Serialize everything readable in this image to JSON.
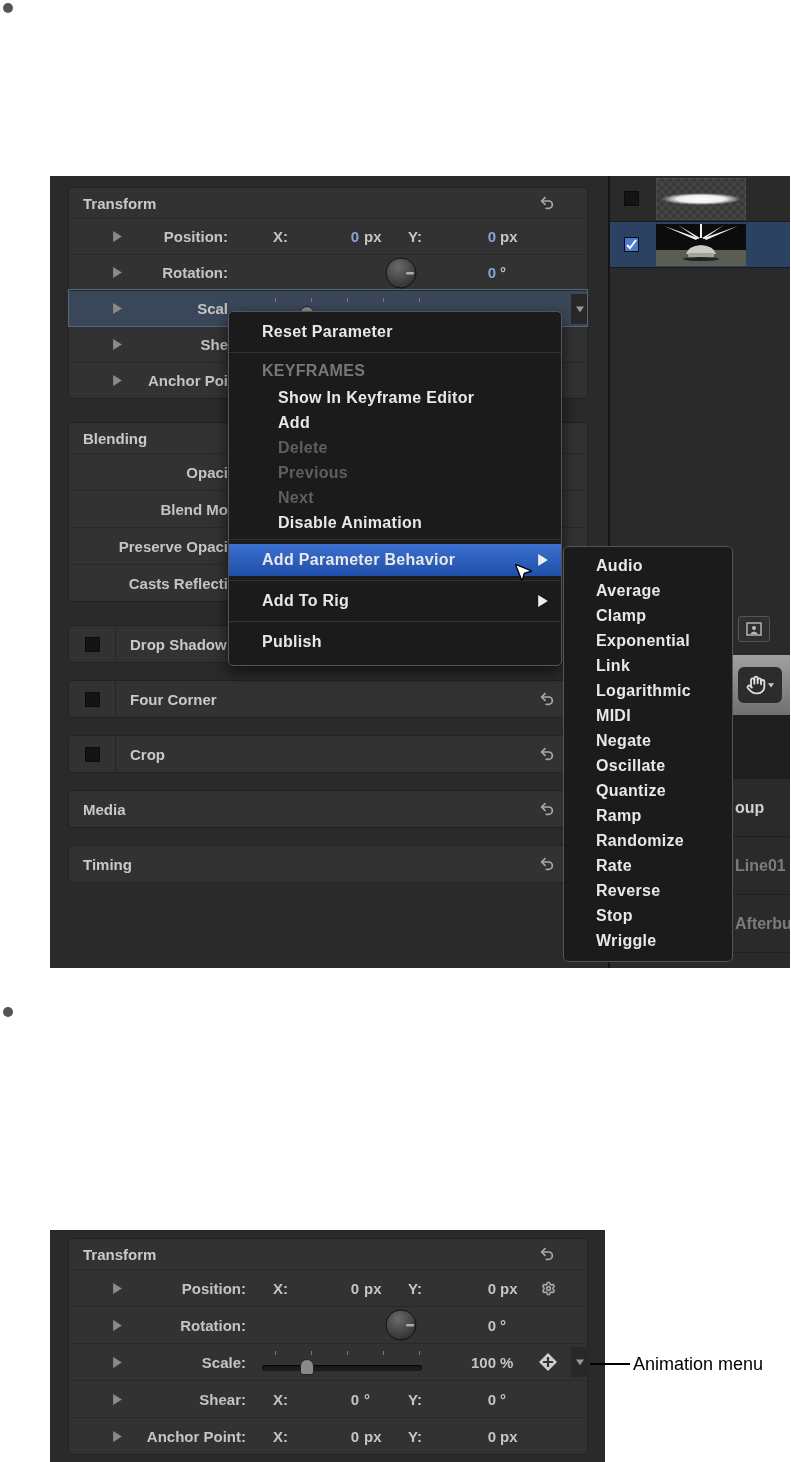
{
  "figure_1": {
    "inspector": {
      "values_tinted": true,
      "cards": [
        {
          "kind": "group",
          "title": "Transform",
          "reset_icon": true,
          "rows": [
            {
              "kind": "xy",
              "label": "Position:",
              "expanded": false,
              "selected": false,
              "x_label": "X:",
              "x_value": "0",
              "x_unit": "px",
              "y_label": "Y:",
              "y_value": "0",
              "y_unit": "px"
            },
            {
              "kind": "dial",
              "label": "Rotation:",
              "expanded": false,
              "selected": false,
              "value": "0",
              "unit": "°"
            },
            {
              "kind": "slider",
              "label": "Scal",
              "expanded": false,
              "selected": true,
              "level": 0.28,
              "animation_menu": true
            },
            {
              "kind": "label",
              "label": "She",
              "expanded": false,
              "selected": false
            },
            {
              "kind": "label",
              "label": "Anchor Poi",
              "expanded": false,
              "selected": false
            }
          ]
        },
        {
          "kind": "group",
          "title": "Blending",
          "reset_icon": false,
          "rows": [
            {
              "kind": "label",
              "label": "Opaci",
              "selected": false
            },
            {
              "kind": "label",
              "label": "Blend Mo",
              "selected": false
            },
            {
              "kind": "label",
              "label": "Preserve Opaci",
              "selected": false
            },
            {
              "kind": "label",
              "label": "Casts Reflecti",
              "selected": false
            }
          ]
        },
        {
          "kind": "toggle",
          "title": "Drop Shadow",
          "enabled": false,
          "reset_icon": false
        },
        {
          "kind": "toggle",
          "title": "Four Corner",
          "enabled": false,
          "reset_icon": true
        },
        {
          "kind": "toggle",
          "title": "Crop",
          "enabled": false,
          "reset_icon": true
        },
        {
          "kind": "group",
          "title": "Media",
          "reset_icon": true
        },
        {
          "kind": "group",
          "title": "Timing",
          "reset_icon": true
        }
      ]
    },
    "layers": [
      {
        "kind": "glow",
        "checked": false,
        "selected": false
      },
      {
        "kind": "picture",
        "checked": true,
        "selected": true
      }
    ],
    "list_rows": [
      {
        "label": "oup",
        "dimmed": false
      },
      {
        "label": "Line01",
        "dimmed": true
      },
      {
        "label": "Afterbu",
        "dimmed": true
      }
    ],
    "context_menu": {
      "items": [
        {
          "kind": "item",
          "label": "Reset Parameter",
          "disabled": false,
          "selected": false,
          "submenu": false
        },
        {
          "kind": "separator"
        },
        {
          "kind": "group",
          "label": "KEYFRAMES",
          "children": [
            {
              "label": "Show In Keyframe Editor",
              "disabled": false,
              "selected": false
            },
            {
              "label": "Add",
              "disabled": false,
              "selected": false
            },
            {
              "label": "Delete",
              "disabled": true,
              "selected": false
            },
            {
              "label": "Previous",
              "disabled": true,
              "selected": false
            },
            {
              "label": "Next",
              "disabled": true,
              "selected": false
            },
            {
              "label": "Disable Animation",
              "disabled": false,
              "selected": false
            }
          ]
        },
        {
          "kind": "separator"
        },
        {
          "kind": "item",
          "label": "Add Parameter Behavior",
          "disabled": false,
          "selected": true,
          "submenu": true
        },
        {
          "kind": "separator"
        },
        {
          "kind": "item",
          "label": "Add To Rig",
          "disabled": false,
          "selected": false,
          "submenu": true
        },
        {
          "kind": "separator"
        },
        {
          "kind": "item",
          "label": "Publish",
          "disabled": false,
          "selected": false,
          "submenu": false
        }
      ]
    },
    "submenu": {
      "items": [
        {
          "label": "Audio",
          "selected": false
        },
        {
          "label": "Average",
          "selected": false
        },
        {
          "label": "Clamp",
          "selected": false
        },
        {
          "label": "Exponential",
          "selected": false
        },
        {
          "label": "Link",
          "selected": false
        },
        {
          "label": "Logarithmic",
          "selected": false
        },
        {
          "label": "MIDI",
          "selected": false
        },
        {
          "label": "Negate",
          "selected": false
        },
        {
          "label": "Oscillate",
          "selected": false
        },
        {
          "label": "Quantize",
          "selected": false
        },
        {
          "label": "Ramp",
          "selected": false
        },
        {
          "label": "Randomize",
          "selected": false
        },
        {
          "label": "Rate",
          "selected": false
        },
        {
          "label": "Reverse",
          "selected": false
        },
        {
          "label": "Stop",
          "selected": false
        },
        {
          "label": "Wriggle",
          "selected": false
        }
      ]
    }
  },
  "figure_2": {
    "inspector": {
      "values_tinted": false,
      "cards": [
        {
          "kind": "group",
          "title": "Transform",
          "reset_icon": true,
          "rows": [
            {
              "kind": "xy",
              "label": "Position:",
              "expanded": false,
              "selected": false,
              "x_label": "X:",
              "x_value": "0",
              "x_unit": "px",
              "y_label": "Y:",
              "y_value": "0",
              "y_unit": "px",
              "gear_icon": true
            },
            {
              "kind": "dial",
              "label": "Rotation:",
              "expanded": false,
              "selected": false,
              "value": "0",
              "unit": "°"
            },
            {
              "kind": "slider",
              "label": "Scale:",
              "expanded": false,
              "selected": false,
              "level": 0.28,
              "value": "100",
              "unit": "%",
              "keyframe_icon": true,
              "animation_menu": true
            },
            {
              "kind": "xy",
              "label": "Shear:",
              "expanded": false,
              "selected": false,
              "x_label": "X:",
              "x_value": "0",
              "x_unit": "°",
              "y_label": "Y:",
              "y_value": "0",
              "y_unit": "°"
            },
            {
              "kind": "xy",
              "label": "Anchor Point:",
              "expanded": false,
              "selected": false,
              "x_label": "X:",
              "x_value": "0",
              "x_unit": "px",
              "y_label": "Y:",
              "y_value": "0",
              "y_unit": "px"
            }
          ]
        }
      ]
    },
    "callout": {
      "label": "Animation menu"
    }
  }
}
